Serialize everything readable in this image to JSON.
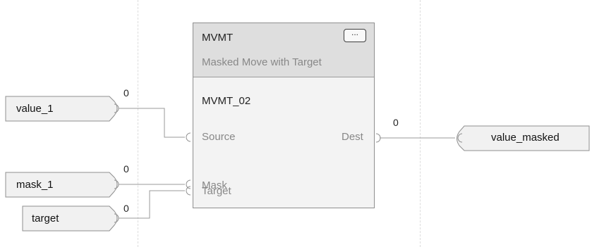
{
  "block": {
    "name": "MVMT",
    "description": "Masked Move with Target",
    "instance": "MVMT_02",
    "ellipsis_label": "...",
    "pins": {
      "source": "Source",
      "mask": "Mask",
      "target": "Target",
      "dest": "Dest"
    }
  },
  "inputs": [
    {
      "tag": "value_1",
      "value": "0"
    },
    {
      "tag": "mask_1",
      "value": "0"
    },
    {
      "tag": "target",
      "value": "0"
    }
  ],
  "output": {
    "tag": "value_masked",
    "value": "0"
  }
}
